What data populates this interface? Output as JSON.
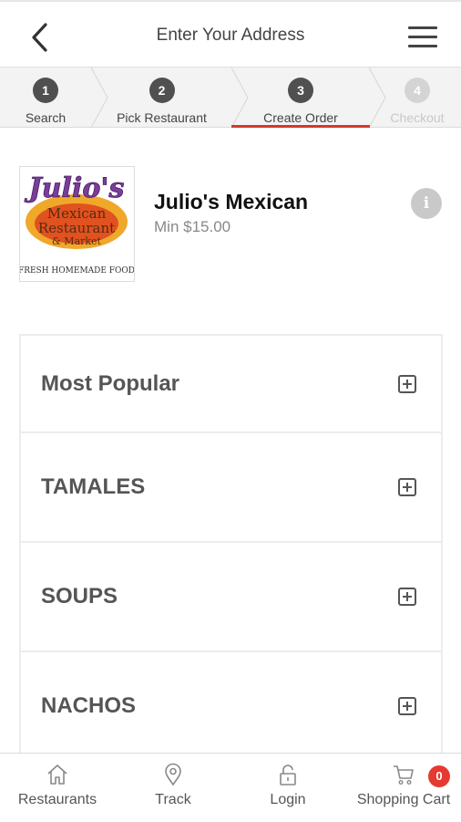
{
  "header": {
    "title": "Enter Your Address"
  },
  "steps": [
    {
      "num": "1",
      "label": "Search"
    },
    {
      "num": "2",
      "label": "Pick Restaurant"
    },
    {
      "num": "3",
      "label": "Create Order"
    },
    {
      "num": "4",
      "label": "Checkout"
    }
  ],
  "restaurant": {
    "name": "Julio's Mexican",
    "min": "Min $15.00",
    "info_glyph": "i",
    "logo": {
      "l1": "Julio's",
      "l2": "Mexican",
      "l3": "Restaurant",
      "l4": "& Market",
      "l5": "\"FRESH HOMEMADE FOOD\""
    }
  },
  "categories": [
    {
      "name": "Most Popular"
    },
    {
      "name": "TAMALES"
    },
    {
      "name": "SOUPS"
    },
    {
      "name": "NACHOS"
    }
  ],
  "nav": [
    {
      "label": "Restaurants",
      "icon": "home-icon"
    },
    {
      "label": "Track",
      "icon": "map-pin-icon"
    },
    {
      "label": "Login",
      "icon": "lock-icon"
    },
    {
      "label": "Shopping Cart",
      "icon": "cart-icon",
      "badge": "0"
    }
  ],
  "colors": {
    "accent": "#d23a2e",
    "badge": "#e53a2f"
  }
}
